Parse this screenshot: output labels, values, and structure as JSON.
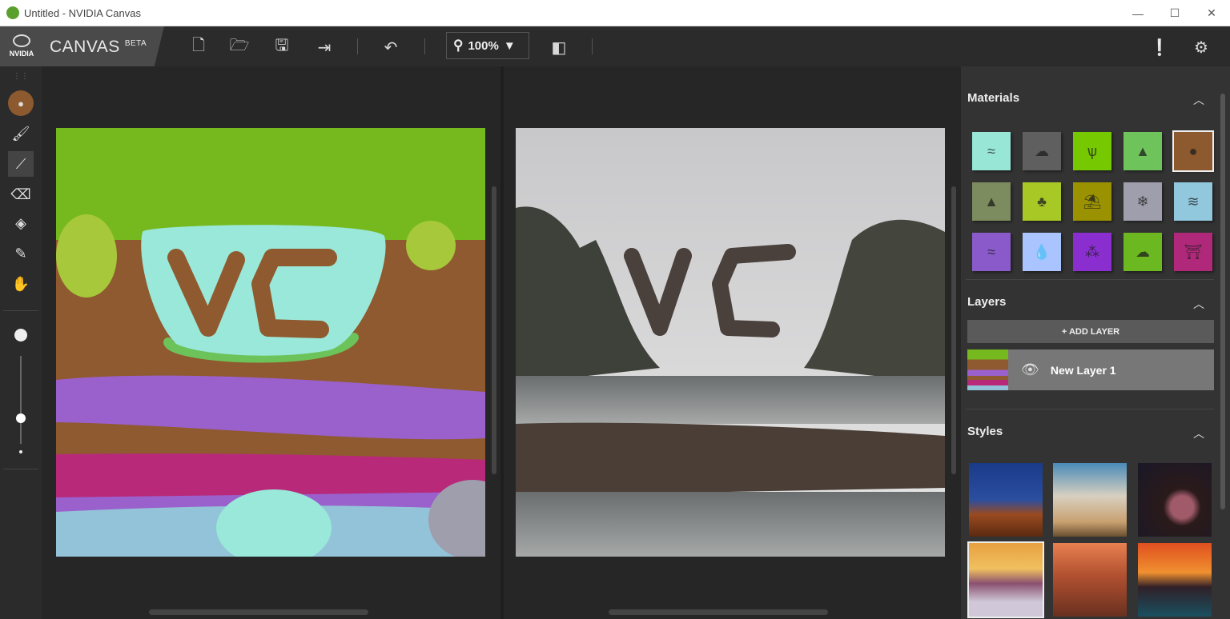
{
  "window": {
    "title": "Untitled - NVIDIA Canvas",
    "minimize": "—",
    "maximize": "☐",
    "close": "✕"
  },
  "logo": {
    "brand": "NVIDIA",
    "app": "CANVAS",
    "badge": "BETA"
  },
  "toolbar": {
    "zoom_value": "100%",
    "icons": [
      "new-file",
      "open-folder",
      "save",
      "export",
      "undo",
      "zoom",
      "compare"
    ]
  },
  "left_tools": [
    "material-picker",
    "brush",
    "line",
    "eraser",
    "fill",
    "eyedropper",
    "pan"
  ],
  "brush_size_percent": 40,
  "panel": {
    "materials_title": "Materials",
    "materials": [
      {
        "name": "sea",
        "color": "#97e6d6"
      },
      {
        "name": "cloud",
        "color": "#5f5f5f"
      },
      {
        "name": "grass",
        "color": "#76c900"
      },
      {
        "name": "hill",
        "color": "#6ec35a"
      },
      {
        "name": "rock",
        "color": "#8c5a2e",
        "selected": true
      },
      {
        "name": "mountain",
        "color": "#7c8c5e"
      },
      {
        "name": "tree",
        "color": "#a8c826"
      },
      {
        "name": "sand",
        "color": "#9a9200"
      },
      {
        "name": "snow",
        "color": "#9e9eac"
      },
      {
        "name": "water",
        "color": "#92c8de"
      },
      {
        "name": "river",
        "color": "#8a5acb"
      },
      {
        "name": "sky",
        "color": "#aac4ff"
      },
      {
        "name": "flowers",
        "color": "#8a2ed0"
      },
      {
        "name": "fog",
        "color": "#6cb820"
      },
      {
        "name": "building",
        "color": "#b0287a"
      }
    ],
    "layers_title": "Layers",
    "add_layer": "+ ADD LAYER",
    "layers": [
      {
        "name": "New Layer 1",
        "visible": true
      }
    ],
    "styles_title": "Styles",
    "selected_style": 3
  }
}
